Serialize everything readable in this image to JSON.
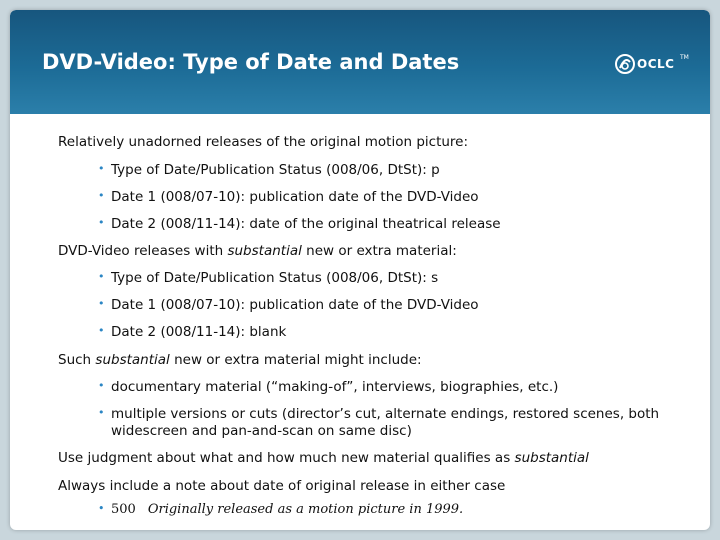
{
  "title": "DVD-Video:  Type of Date and Dates",
  "logo_text": "OCLC",
  "logo_tm": "TM",
  "sections": {
    "s1": {
      "heading": "Relatively unadorned releases of the original motion picture:",
      "bullets": [
        "Type of Date/Publication Status (008/06, DtSt):  p",
        "Date 1 (008/07-10):  publication date of the DVD-Video",
        "Date 2 (008/11-14):  date of the original theatrical release"
      ]
    },
    "s2": {
      "heading_pre": "DVD-Video releases with ",
      "heading_em": "substantial",
      "heading_post": " new or extra material:",
      "bullets": [
        "Type of Date/Publication Status (008/06, DtSt):  s",
        "Date 1 (008/07-10):  publication date of the DVD-Video",
        "Date 2 (008/11-14):  blank"
      ]
    },
    "s3": {
      "heading_pre": "Such ",
      "heading_em": "substantial",
      "heading_post": " new or extra material might include:",
      "bullets": [
        "documentary material (“making-of”, interviews, biographies, etc.)",
        "multiple versions or cuts (director’s cut, alternate endings, restored scenes, both widescreen and pan-and-scan on same disc)"
      ]
    },
    "s4": {
      "line_pre": "Use judgment about what and how much new material qualifies as ",
      "line_em": "substantial"
    },
    "s5": {
      "line": "Always include a note about date of original release in either case",
      "note_code": "500",
      "note_text": "Originally released as a motion picture in 1999."
    }
  },
  "bullet_glyph": "•",
  "colors": {
    "header": "#1c6b96",
    "bullet": "#2b86c4",
    "background": "#c9d6dc"
  }
}
